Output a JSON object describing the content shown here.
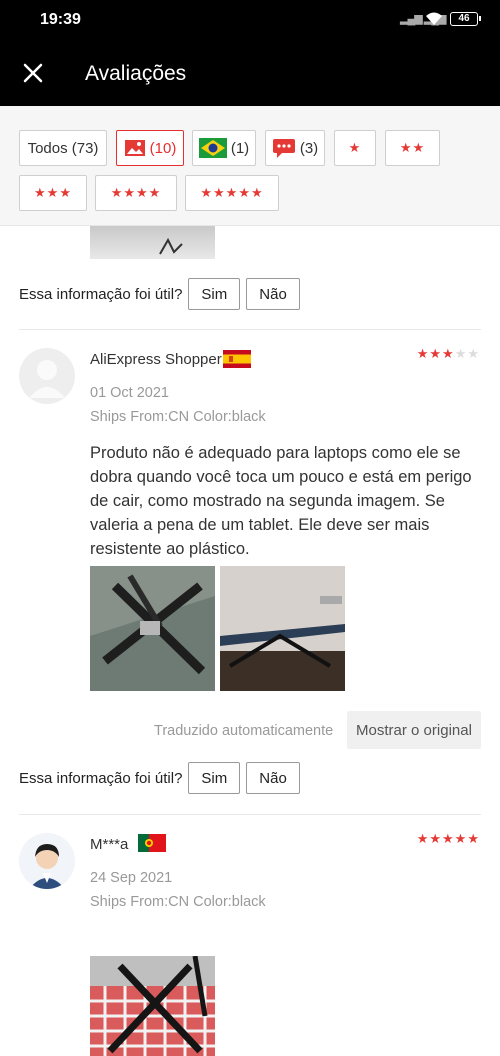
{
  "status_bar": {
    "time": "19:39",
    "battery": "46"
  },
  "header": {
    "title": "Avaliações",
    "close_icon": "close-icon"
  },
  "filters": {
    "all_label": "Todos (73)",
    "photo_count": "(10)",
    "country_count": "(1)",
    "comment_count": "(3)",
    "star_filters": [
      "★",
      "★★",
      "★★★",
      "★★★★",
      "★★★★★"
    ]
  },
  "helpful": {
    "question": "Essa informação foi útil?",
    "yes": "Sim",
    "no": "Não"
  },
  "reviews": [
    {
      "name": "AliExpress Shopper",
      "country": "Spain",
      "rating": 3,
      "date": "01 Oct 2021",
      "meta": "Ships From:CN Color:black",
      "text": "Produto não é adequado para laptops como ele se dobra quando você toca um pouco e está em perigo de cair, como mostrado na segunda imagem. Se valeria a pena de um tablet. Ele deve ser mais resistente ao plástico.",
      "auto_translated": "Traduzido automaticamente",
      "show_original": "Mostrar o original"
    },
    {
      "name": "M***a",
      "country": "Portugal",
      "rating": 5,
      "date": "24 Sep 2021",
      "meta": "Ships From:CN Color:black"
    }
  ],
  "colors": {
    "accent_red": "#e53935",
    "header_bg": "#000000"
  }
}
